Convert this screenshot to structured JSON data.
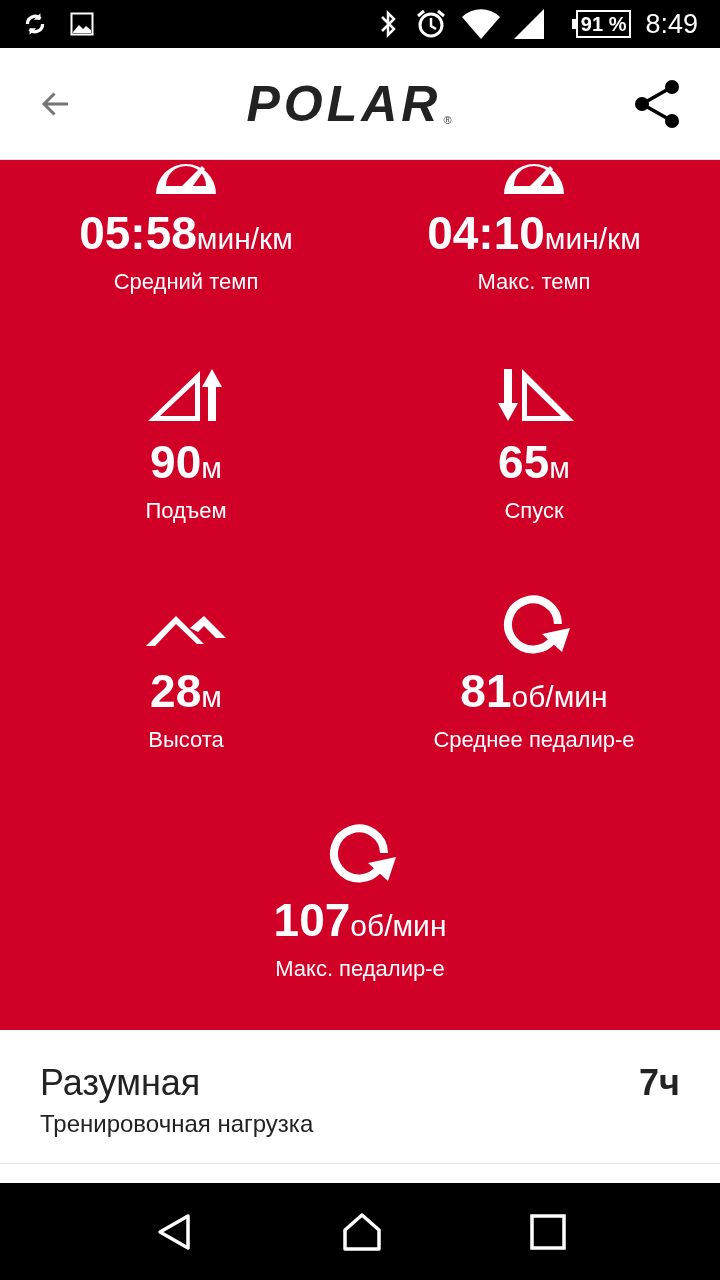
{
  "status_bar": {
    "battery": "91 %",
    "time": "8:49"
  },
  "header": {
    "logo": "POLAR",
    "trademark": "®"
  },
  "stats": [
    {
      "kind": "speedometer",
      "value": "05:58",
      "unit": "мин/км",
      "label": "Средний темп"
    },
    {
      "kind": "speedometer",
      "value": "04:10",
      "unit": "мин/км",
      "label": "Макс. темп"
    },
    {
      "kind": "ascent",
      "value": "90",
      "unit": "м",
      "label": "Подъем"
    },
    {
      "kind": "descent",
      "value": "65",
      "unit": "м",
      "label": "Спуск"
    },
    {
      "kind": "altitude",
      "value": "28",
      "unit": "м",
      "label": "Высота"
    },
    {
      "kind": "cadence",
      "value": "81",
      "unit": "об/мин",
      "label": "Среднее педалир-е"
    },
    {
      "kind": "cadence",
      "value": "107",
      "unit": "об/мин",
      "label": "Макс. педалир-е"
    }
  ],
  "training_load": {
    "title": "Разумная",
    "subtitle": "Тренировочная нагрузка",
    "value": "7ч"
  }
}
